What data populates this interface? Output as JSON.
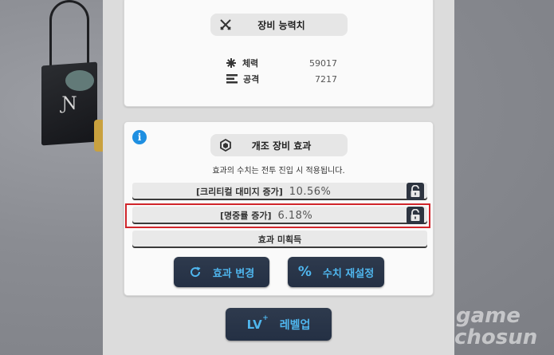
{
  "equipment_stats": {
    "title": "장비 능력치",
    "rows": [
      {
        "icon": "asterisk-icon",
        "label": "체력",
        "value": "59017"
      },
      {
        "icon": "bars-icon",
        "label": "공격",
        "value": "7217"
      }
    ]
  },
  "modification": {
    "title": "개조 장비 효과",
    "note": "효과의 수치는 전투 진입 시 적용됩니다.",
    "effects": [
      {
        "label": "[크리티컬 대미지 증가]",
        "value": "10.56%",
        "locked": true
      },
      {
        "label": "[명중률 증가]",
        "value": "6.18%",
        "locked": true
      }
    ],
    "unacquired_label": "효과 미획득",
    "buttons": {
      "change_effect": "효과 변경",
      "reset_value": "수치 재설정"
    }
  },
  "level_up": {
    "icon_text": "LV",
    "icon_sup": "+",
    "label": "레벨업"
  },
  "watermark": {
    "line1": "game",
    "line2": "chosun"
  },
  "colors": {
    "accent_blue": "#4fb6ee",
    "button_bg": "#2a3547",
    "highlight_red": "#d0252b",
    "info_blue": "#1e8fe1"
  }
}
